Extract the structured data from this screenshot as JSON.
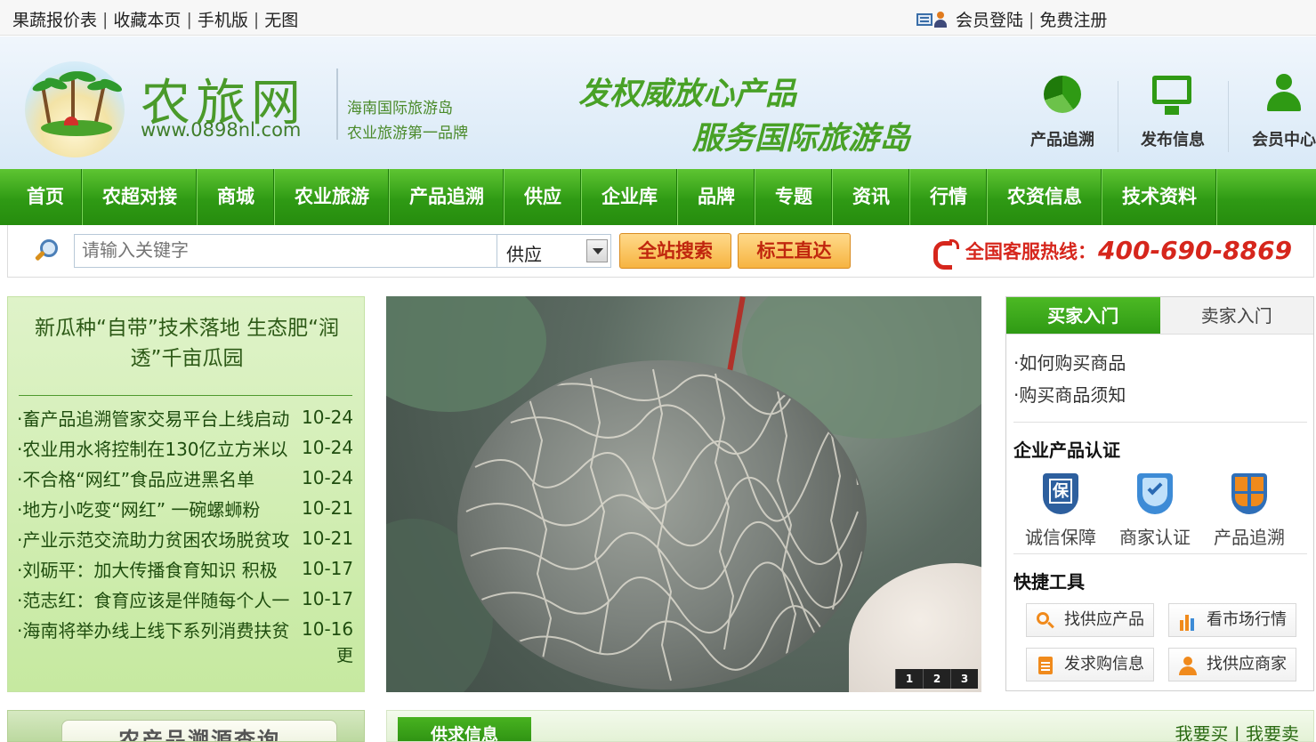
{
  "topbar": {
    "links": [
      "果蔬报价表",
      "收藏本页",
      "手机版",
      "无图"
    ],
    "login": "会员登陆",
    "register": "免费注册",
    "separator": "|"
  },
  "header": {
    "logo_title": "农旅网",
    "logo_url": "www.0898nl.com",
    "slogan_line1": "海南国际旅游岛",
    "slogan_line2": "农业旅游第一品牌",
    "banner_line1": "发权威放心产品",
    "banner_line2": "服务国际旅游岛",
    "icons": [
      {
        "label": "产品追溯",
        "icon": "pie-chart-icon"
      },
      {
        "label": "发布信息",
        "icon": "monitor-icon"
      },
      {
        "label": "会员中心",
        "icon": "user-icon"
      }
    ]
  },
  "nav": {
    "items": [
      "首页",
      "农超对接",
      "商城",
      "农业旅游",
      "产品追溯",
      "供应",
      "企业库",
      "品牌",
      "专题",
      "资讯",
      "行情",
      "农资信息",
      "技术资料"
    ]
  },
  "search": {
    "placeholder": "请输入关键字",
    "category": "供应",
    "btn_all": "全站搜索",
    "btn_direct": "标王直达",
    "hotline_label": "全国客服热线：",
    "hotline_number": "400-690-8869"
  },
  "news": {
    "headline": "新瓜种“自带”技术落地 生态肥“润透”千亩瓜园",
    "items": [
      {
        "title": "·畜产品追溯管家交易平台上线启动",
        "date": "10-24"
      },
      {
        "title": "·农业用水将控制在130亿立方米以",
        "date": "10-24"
      },
      {
        "title": "·不合格“网红”食品应进黑名单",
        "date": "10-24"
      },
      {
        "title": "·地方小吃变“网红” 一碗螺蛳粉",
        "date": "10-21"
      },
      {
        "title": "·产业示范交流助力贫困农场脱贫攻",
        "date": "10-21"
      },
      {
        "title": "·刘砺平：加大传播食育知识 积极",
        "date": "10-17"
      },
      {
        "title": "·范志红：食育应该是伴随每个人一",
        "date": "10-17"
      },
      {
        "title": "·海南将举办线上线下系列消费扶贫",
        "date": "10-16"
      }
    ],
    "more": "更"
  },
  "slider": {
    "pages": [
      "1",
      "2",
      "3"
    ]
  },
  "buyer": {
    "tab_active": "买家入门",
    "tab_inactive": "卖家入门",
    "links": [
      "·如何购买商品",
      "·购买商品须知"
    ],
    "cert_title": "企业产品认证",
    "certs": [
      {
        "label": "诚信保障",
        "icon": "shield-bao-icon"
      },
      {
        "label": "商家认证",
        "icon": "check-shield-icon"
      },
      {
        "label": "产品追溯",
        "icon": "cross-shield-icon"
      }
    ],
    "tools_title": "快捷工具",
    "tools": [
      {
        "label": "找供应产品",
        "icon": "search-icon"
      },
      {
        "label": "看市场行情",
        "icon": "bar-chart-icon"
      },
      {
        "label": "发求购信息",
        "icon": "document-icon"
      },
      {
        "label": "找供应商家",
        "icon": "person-icon"
      }
    ]
  },
  "bottom": {
    "trace_label": "农产品溯源查询",
    "supply_tab": "供求信息",
    "buy_link": "我要买",
    "sell_link": "我要卖"
  },
  "colors": {
    "nav_green": "#2f9a14",
    "hotline_red": "#d6261c",
    "button_orange": "#f6b441"
  }
}
